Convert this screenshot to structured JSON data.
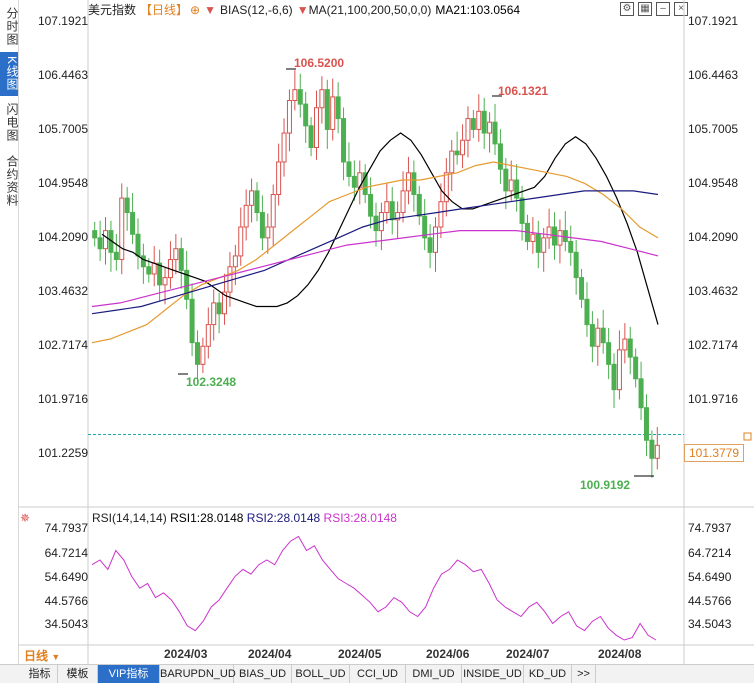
{
  "left_tabs": [
    {
      "label": "分时图",
      "active": false
    },
    {
      "label": "K线图",
      "active": true
    },
    {
      "label": "闪电图",
      "active": false
    },
    {
      "label": "合约资料",
      "active": false
    }
  ],
  "header": {
    "instrument": "美元指数",
    "period_tag": "【日线】",
    "bias_label": "BIAS(12,-6,6)",
    "ma_label": "MA(21,100,200,50,0,0)",
    "ma21_value": "MA21:103.0564"
  },
  "rsi_header": {
    "label": "RSI(14,14,14)",
    "rsi1": "RSI1:28.0148",
    "rsi2": "RSI2:28.0148",
    "rsi3": "RSI3:28.0148"
  },
  "price_axis": [
    "107.1921",
    "106.4463",
    "105.7005",
    "104.9548",
    "104.2090",
    "103.4632",
    "102.7174",
    "101.9716",
    "101.2259"
  ],
  "rsi_axis": [
    "74.7937",
    "64.7214",
    "54.6490",
    "44.5766",
    "34.5043"
  ],
  "last_price": "101.3779",
  "annotations": {
    "high1": "106.5200",
    "high2": "106.1321",
    "low1": "102.3248",
    "low2": "100.9192"
  },
  "date_labels": [
    "2024/03",
    "2024/04",
    "2024/05",
    "2024/06",
    "2024/07",
    "2024/08"
  ],
  "period_selector": "日线",
  "bottom_tabs": [
    "指标",
    "模板",
    "VIP指标",
    "BARUPDN_UD",
    "BIAS_UD",
    "BOLL_UD",
    "CCI_UD",
    "DMI_UD",
    "INSIDE_UD",
    "KD_UD",
    ">>"
  ],
  "colors": {
    "up": "#d9534f",
    "down": "#4caf50",
    "ma21": "#000000",
    "ma100": "#1a1a80",
    "ma200": "#cc33cc",
    "ma50": "#e69a30",
    "rsi": "#cc33cc",
    "accent": "#2b6fc9"
  },
  "chart_data": {
    "type": "candlestick",
    "title": "美元指数 【日线】",
    "ylim": [
      100.9,
      107.25
    ],
    "low_points": [
      {
        "date": "2024/03",
        "value": 102.3248
      },
      {
        "date": "2024/08",
        "value": 100.9192
      }
    ],
    "high_points": [
      {
        "date": "2024/04",
        "value": 106.52
      },
      {
        "date": "2024/06",
        "value": 106.1321
      }
    ],
    "last": 101.3779,
    "closes": [
      104.25,
      104.1,
      104.35,
      104.05,
      103.95,
      104.8,
      104.6,
      104.3,
      104.0,
      103.85,
      103.75,
      103.9,
      103.6,
      103.7,
      103.95,
      104.1,
      103.8,
      103.4,
      102.8,
      102.5,
      102.75,
      103.05,
      103.35,
      103.2,
      103.5,
      103.85,
      104.0,
      104.4,
      104.7,
      104.9,
      104.6,
      104.25,
      104.4,
      104.85,
      105.3,
      105.7,
      106.15,
      106.3,
      106.1,
      105.8,
      105.5,
      106.05,
      106.3,
      105.75,
      106.2,
      105.9,
      105.3,
      105.1,
      104.95,
      105.15,
      104.85,
      104.55,
      104.35,
      104.6,
      104.75,
      104.5,
      104.6,
      104.9,
      105.15,
      104.85,
      104.55,
      104.25,
      104.05,
      104.4,
      104.75,
      105.15,
      105.45,
      105.4,
      105.6,
      105.9,
      105.75,
      106.0,
      105.7,
      105.85,
      105.55,
      105.2,
      104.9,
      105.05,
      104.8,
      104.45,
      104.2,
      104.3,
      104.05,
      104.25,
      104.4,
      104.15,
      104.35,
      104.2,
      104.05,
      103.7,
      103.4,
      103.05,
      102.75,
      103.0,
      102.8,
      102.5,
      102.15,
      102.7,
      102.85,
      102.6,
      102.3,
      101.9,
      101.45,
      101.2,
      101.38
    ],
    "ma21": [
      104.3,
      104.2,
      104.1,
      104.05,
      103.95,
      103.9,
      103.85,
      103.8,
      103.75,
      103.7,
      103.65,
      103.55,
      103.45,
      103.4,
      103.35,
      103.3,
      103.3,
      103.3,
      103.35,
      103.45,
      103.6,
      103.8,
      104.05,
      104.35,
      104.65,
      104.95,
      105.2,
      105.45,
      105.6,
      105.7,
      105.6,
      105.4,
      105.15,
      104.9,
      104.75,
      104.65,
      104.65,
      104.7,
      104.75,
      104.8,
      104.85,
      104.9,
      104.95,
      105.1,
      105.35,
      105.55,
      105.65,
      105.55,
      105.35,
      105.1,
      104.8,
      104.45,
      104.05,
      103.55,
      103.05
    ],
    "ma50": [
      102.8,
      102.85,
      102.95,
      103.05,
      103.25,
      103.45,
      103.6,
      103.7,
      103.8,
      103.95,
      104.15,
      104.35,
      104.55,
      104.75,
      104.85,
      104.95,
      105.0,
      105.05,
      105.05,
      105.1,
      105.15,
      105.25,
      105.3,
      105.25,
      105.2,
      105.15,
      105.1,
      105.0,
      104.85,
      104.65,
      104.4,
      104.25
    ],
    "ma100": [
      103.2,
      103.25,
      103.3,
      103.4,
      103.5,
      103.6,
      103.7,
      103.8,
      103.95,
      104.1,
      104.25,
      104.4,
      104.5,
      104.55,
      104.6,
      104.65,
      104.7,
      104.75,
      104.8,
      104.85,
      104.9,
      104.9,
      104.9,
      104.85
    ],
    "ma200": [
      103.3,
      103.35,
      103.45,
      103.55,
      103.65,
      103.75,
      103.85,
      103.95,
      104.05,
      104.15,
      104.2,
      104.25,
      104.3,
      104.35,
      104.35,
      104.35,
      104.3,
      104.25,
      104.2,
      104.1,
      104.0
    ],
    "rsi": [
      60,
      62,
      58,
      66,
      62,
      55,
      50,
      52,
      46,
      48,
      45,
      40,
      34,
      32,
      36,
      42,
      45,
      50,
      55,
      58,
      56,
      60,
      62,
      60,
      66,
      70,
      72,
      66,
      68,
      62,
      58,
      54,
      52,
      50,
      47,
      44,
      40,
      42,
      46,
      44,
      40,
      38,
      42,
      50,
      56,
      58,
      62,
      60,
      57,
      58,
      52,
      45,
      42,
      40,
      38,
      42,
      44,
      40,
      35,
      38,
      40,
      34,
      32,
      36,
      38,
      33,
      30,
      28,
      29,
      35,
      30,
      28
    ]
  }
}
